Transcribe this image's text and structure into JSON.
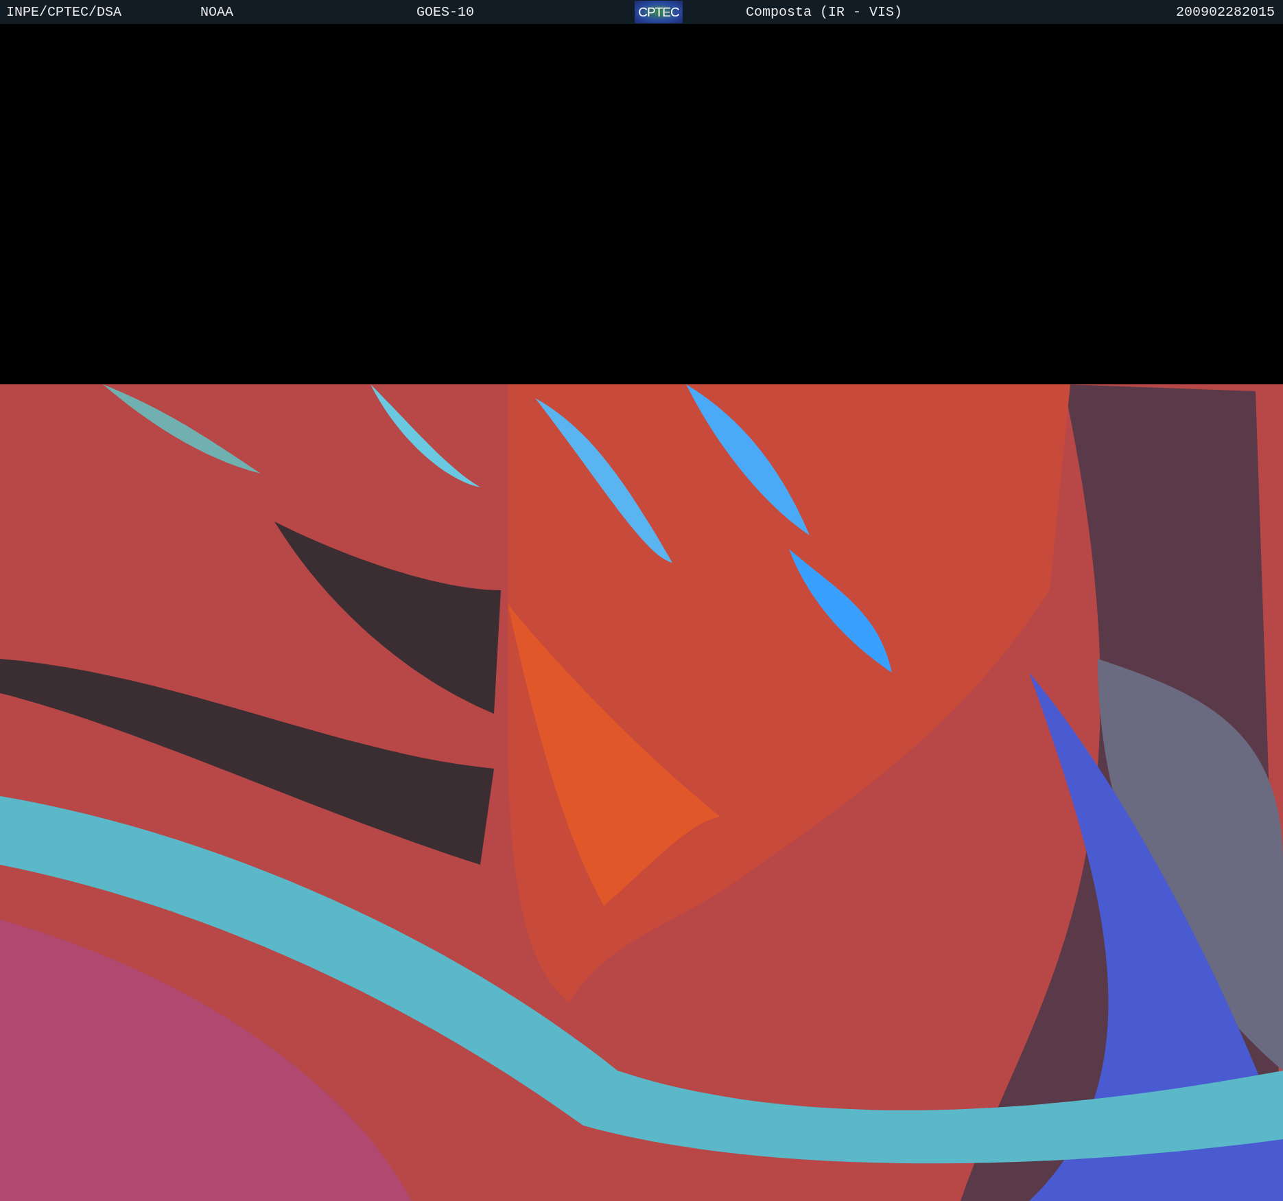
{
  "header": {
    "items": [
      {
        "kind": "text",
        "text": "INPE/CPTEC/DSA"
      },
      {
        "kind": "text",
        "text": "NOAA"
      },
      {
        "kind": "text",
        "text": "GOES-10"
      },
      {
        "kind": "logo",
        "text": "CPTEC"
      },
      {
        "kind": "text",
        "text": "Composta (IR - VIS)"
      },
      {
        "kind": "text",
        "text": "200902282015"
      }
    ]
  }
}
